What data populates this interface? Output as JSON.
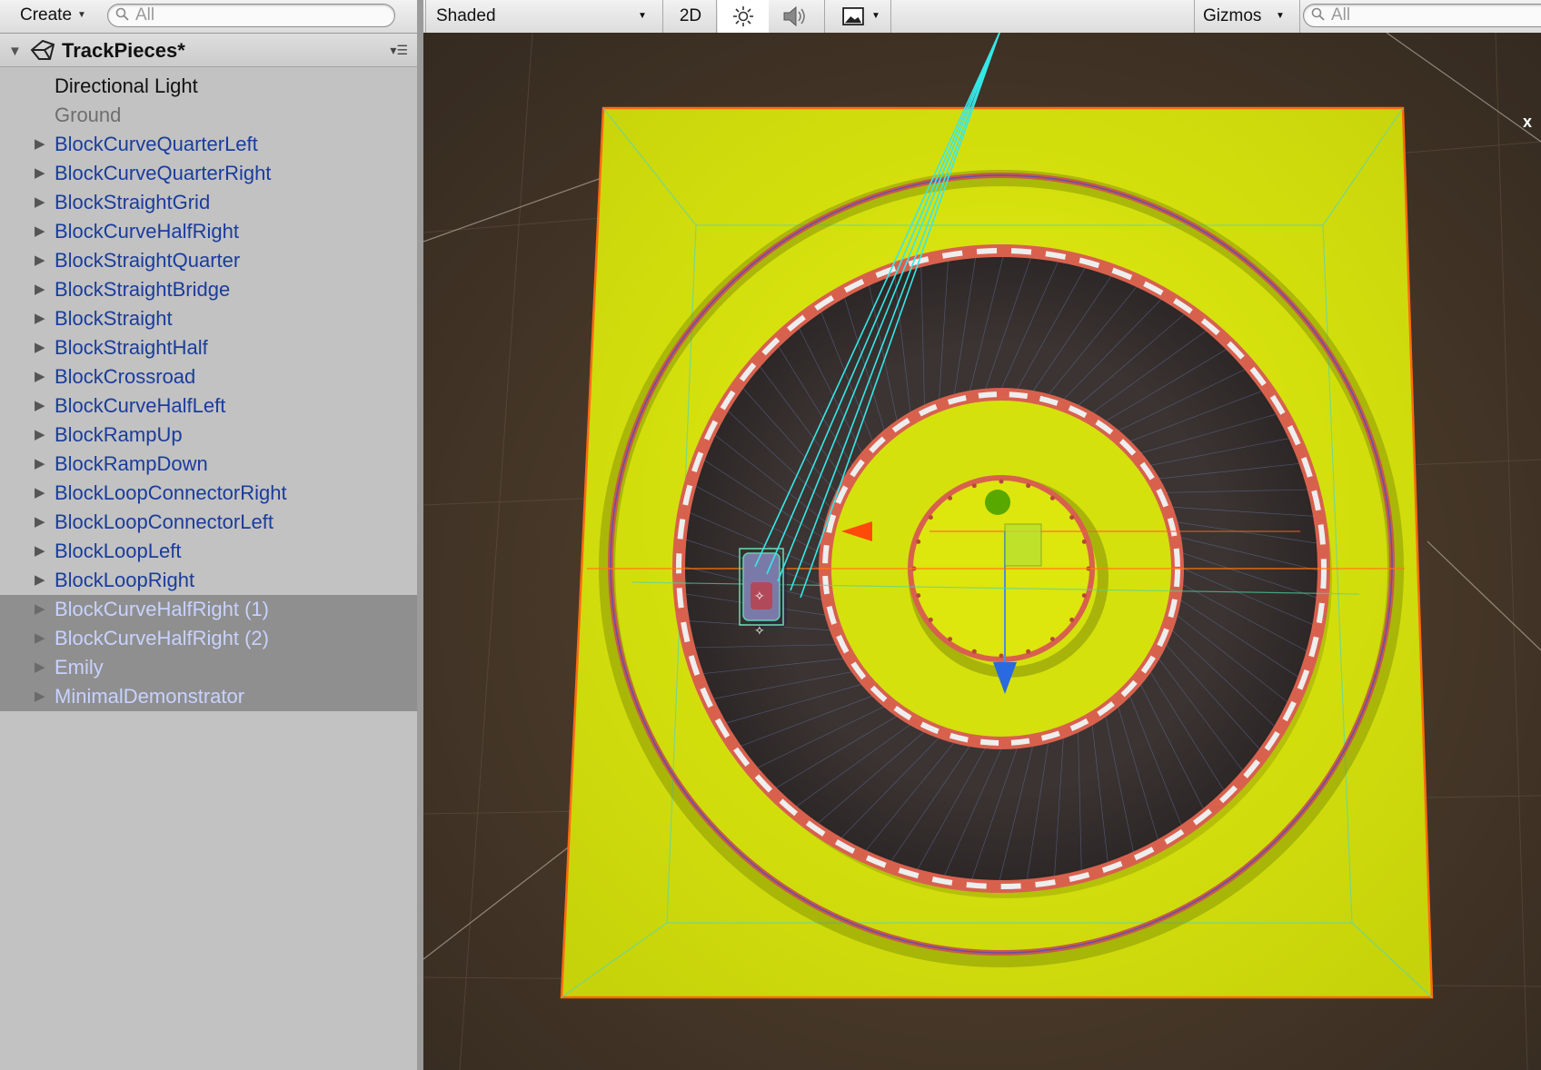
{
  "hierarchy": {
    "create_label": "Create",
    "search_placeholder": "All",
    "scene_name": "TrackPieces*",
    "items": [
      {
        "label": "Directional Light",
        "kind": "plain"
      },
      {
        "label": "Ground",
        "kind": "dim"
      },
      {
        "label": "BlockCurveQuarterLeft",
        "kind": "prefab"
      },
      {
        "label": "BlockCurveQuarterRight",
        "kind": "prefab"
      },
      {
        "label": "BlockStraightGrid",
        "kind": "prefab"
      },
      {
        "label": "BlockCurveHalfRight",
        "kind": "prefab"
      },
      {
        "label": "BlockStraightQuarter",
        "kind": "prefab"
      },
      {
        "label": "BlockStraightBridge",
        "kind": "prefab"
      },
      {
        "label": "BlockStraight",
        "kind": "prefab"
      },
      {
        "label": "BlockStraightHalf",
        "kind": "prefab"
      },
      {
        "label": "BlockCrossroad",
        "kind": "prefab"
      },
      {
        "label": "BlockCurveHalfLeft",
        "kind": "prefab"
      },
      {
        "label": "BlockRampUp",
        "kind": "prefab"
      },
      {
        "label": "BlockRampDown",
        "kind": "prefab"
      },
      {
        "label": "BlockLoopConnectorRight",
        "kind": "prefab"
      },
      {
        "label": "BlockLoopConnectorLeft",
        "kind": "prefab"
      },
      {
        "label": "BlockLoopLeft",
        "kind": "prefab"
      },
      {
        "label": "BlockLoopRight",
        "kind": "prefab"
      },
      {
        "label": "BlockCurveHalfRight (1)",
        "kind": "sel"
      },
      {
        "label": "BlockCurveHalfRight (2)",
        "kind": "sel"
      },
      {
        "label": "Emily",
        "kind": "sel"
      },
      {
        "label": "MinimalDemonstrator",
        "kind": "sel"
      }
    ]
  },
  "scene_view": {
    "shading_mode": "Shaded",
    "mode_2d": "2D",
    "gizmos_label": "Gizmos",
    "search_placeholder": "All",
    "axis_label": "x"
  },
  "colors": {
    "ground": "#d4e010",
    "track": "#3a3230",
    "rail": "#d8614e",
    "background": "#4a3a2a",
    "selection_outline": "#ff7a1a",
    "prefab_text": "#1a3c9c"
  }
}
